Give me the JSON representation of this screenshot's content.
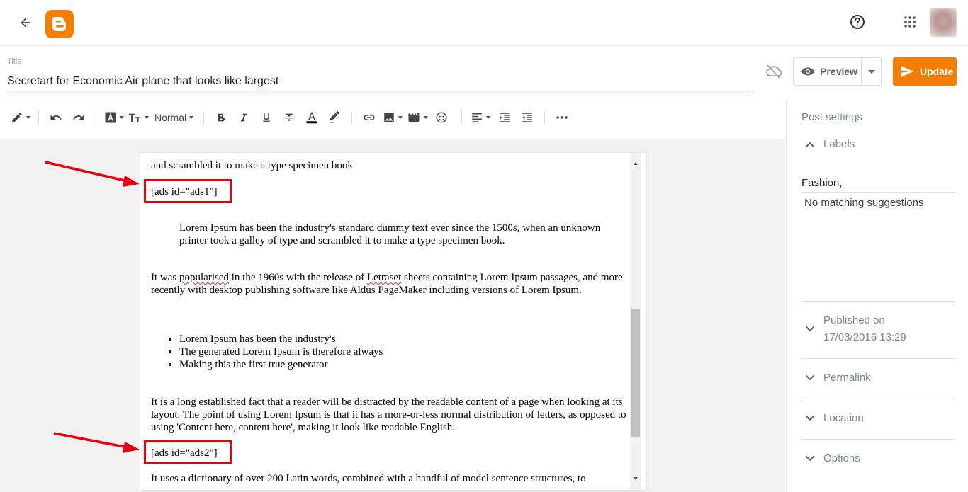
{
  "header": {
    "back_icon": "arrow-left-icon",
    "logo_icon": "blogger-logo-icon",
    "help_icon": "help-circle-icon",
    "apps_icon": "apps-grid-icon"
  },
  "title": {
    "label": "Title",
    "value": "Secretart for Economic Air plane that looks like largest"
  },
  "actions": {
    "preview_label": "Preview",
    "update_label": "Update"
  },
  "toolbar": {
    "font_size_label": "Normal"
  },
  "document": {
    "line1": "and scrambled it to make a type specimen book",
    "shortcode1": "[ads id=\"ads1\"]",
    "blockquote": "Lorem Ipsum has been the industry's standard dummy text ever since the 1500s, when an unknown printer took a galley of type and scrambled it to make a type specimen book.",
    "para1_pre": "It was ",
    "para1_misspelled": "popularised",
    "para1_mid": " in the 1960s with the release of ",
    "para1_misspelled2": "Letraset",
    "para1_post": " sheets containing Lorem Ipsum passages, and more recently with desktop publishing software like Aldus PageMaker including versions of Lorem Ipsum.",
    "bullets": [
      "Lorem Ipsum has been the industry's",
      "The generated Lorem Ipsum is therefore always",
      "Making this the first true generator"
    ],
    "para2": "It is a long established fact that a reader will be distracted by the readable content of a page when looking at its layout. The point of using Lorem Ipsum is that it has a more-or-less normal distribution of letters, as opposed to using 'Content here, content here', making it look like readable English.",
    "shortcode2": "[ads id=\"ads2\"]",
    "para3": "It uses a dictionary of over 200 Latin words, combined with a handful of model sentence structures, to"
  },
  "sidebar": {
    "title": "Post settings",
    "labels_heading": "Labels",
    "labels_value": "Fashion,",
    "no_match": "No matching suggestions",
    "published_heading": "Published on",
    "published_value": "17/03/2016 13:29",
    "permalink": "Permalink",
    "location": "Location",
    "options": "Options"
  },
  "colors": {
    "accent": "#f57d00",
    "annotation_red": "#e8000d",
    "title_underline": "#e4572e"
  }
}
